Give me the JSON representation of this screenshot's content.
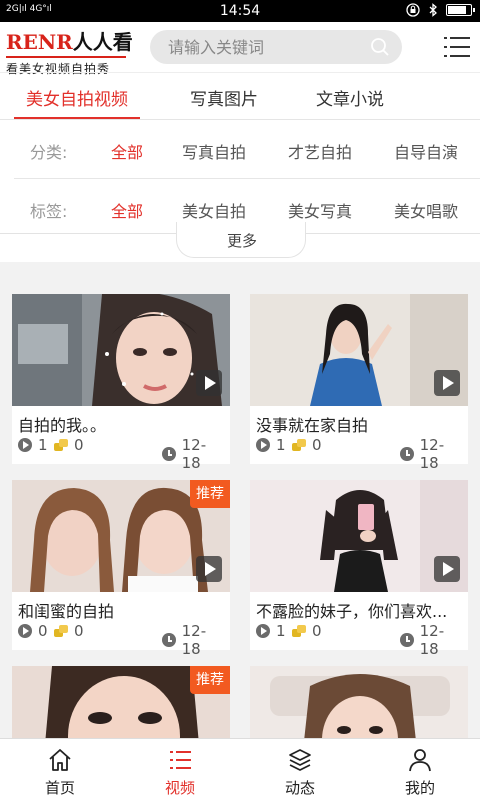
{
  "status_bar": {
    "signal": "2G|ıl 4G°ıl",
    "time": "14:54",
    "battery_level": 0.85
  },
  "header": {
    "logo_main_red": "RENR",
    "logo_main_black": "人人看",
    "logo_sub": "看美女视频自拍秀",
    "search_placeholder": "请输入关键词"
  },
  "tabs": [
    {
      "label": "美女自拍视频",
      "active": true
    },
    {
      "label": "写真图片",
      "active": false
    },
    {
      "label": "文章小说",
      "active": false
    }
  ],
  "filters": {
    "category": {
      "label": "分类:",
      "options": [
        "全部",
        "写真自拍",
        "才艺自拍",
        "自导自演"
      ],
      "selected": "全部"
    },
    "tag": {
      "label": "标签:",
      "options": [
        "全部",
        "美女自拍",
        "美女写真",
        "美女唱歌"
      ],
      "selected": "全部"
    },
    "more_label": "更多"
  },
  "videos": [
    {
      "title": "自拍的我。。",
      "plays": "1",
      "coins": "0",
      "date": "12-18",
      "badge": ""
    },
    {
      "title": "没事就在家自拍",
      "plays": "1",
      "coins": "0",
      "date": "12-18",
      "badge": ""
    },
    {
      "title": "和闺蜜的自拍",
      "plays": "0",
      "coins": "0",
      "date": "12-18",
      "badge": "推荐"
    },
    {
      "title": "不露脸的妹子，你们喜欢...",
      "plays": "1",
      "coins": "0",
      "date": "12-18",
      "badge": ""
    },
    {
      "title": "",
      "plays": "",
      "coins": "",
      "date": "",
      "badge": "推荐"
    },
    {
      "title": "",
      "plays": "",
      "coins": "",
      "date": "",
      "badge": ""
    }
  ],
  "bottom_nav": [
    {
      "label": "首页",
      "icon": "home-icon",
      "active": false
    },
    {
      "label": "视频",
      "icon": "list-icon",
      "active": true
    },
    {
      "label": "动态",
      "icon": "layers-icon",
      "active": false
    },
    {
      "label": "我的",
      "icon": "user-icon",
      "active": false
    }
  ],
  "colors": {
    "accent": "#e2312b",
    "badge": "#f25a20",
    "brand_red": "#d8231a"
  }
}
